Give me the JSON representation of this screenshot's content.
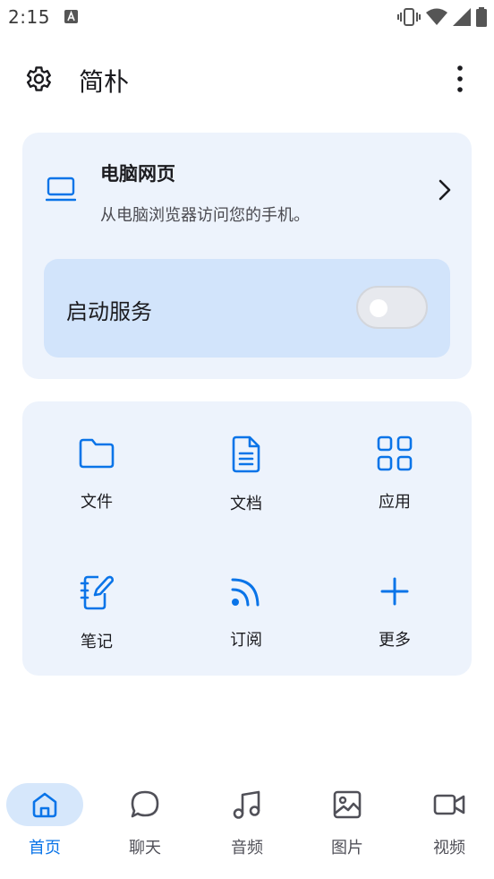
{
  "status_bar": {
    "time": "2:15"
  },
  "app_bar": {
    "title": "简朴"
  },
  "web_card": {
    "title": "电脑网页",
    "subtitle": "从电脑浏览器访问您的手机。",
    "service_label": "启动服务",
    "service_enabled": false
  },
  "grid": {
    "items": [
      {
        "label": "文件",
        "icon": "folder-icon"
      },
      {
        "label": "文档",
        "icon": "document-icon"
      },
      {
        "label": "应用",
        "icon": "apps-grid-icon"
      },
      {
        "label": "笔记",
        "icon": "notebook-icon"
      },
      {
        "label": "订阅",
        "icon": "rss-icon"
      },
      {
        "label": "更多",
        "icon": "plus-icon"
      }
    ]
  },
  "bottom_nav": {
    "items": [
      {
        "label": "首页",
        "icon": "home-icon",
        "active": true
      },
      {
        "label": "聊天",
        "icon": "chat-bubble-icon",
        "active": false
      },
      {
        "label": "音频",
        "icon": "music-note-icon",
        "active": false
      },
      {
        "label": "图片",
        "icon": "image-icon",
        "active": false
      },
      {
        "label": "视频",
        "icon": "video-camera-icon",
        "active": false
      }
    ]
  },
  "colors": {
    "accent": "#0a74e8",
    "card_bg": "#edf3fc",
    "service_bg": "#d2e4fb",
    "nav_active_bg": "#d6e7fb"
  }
}
